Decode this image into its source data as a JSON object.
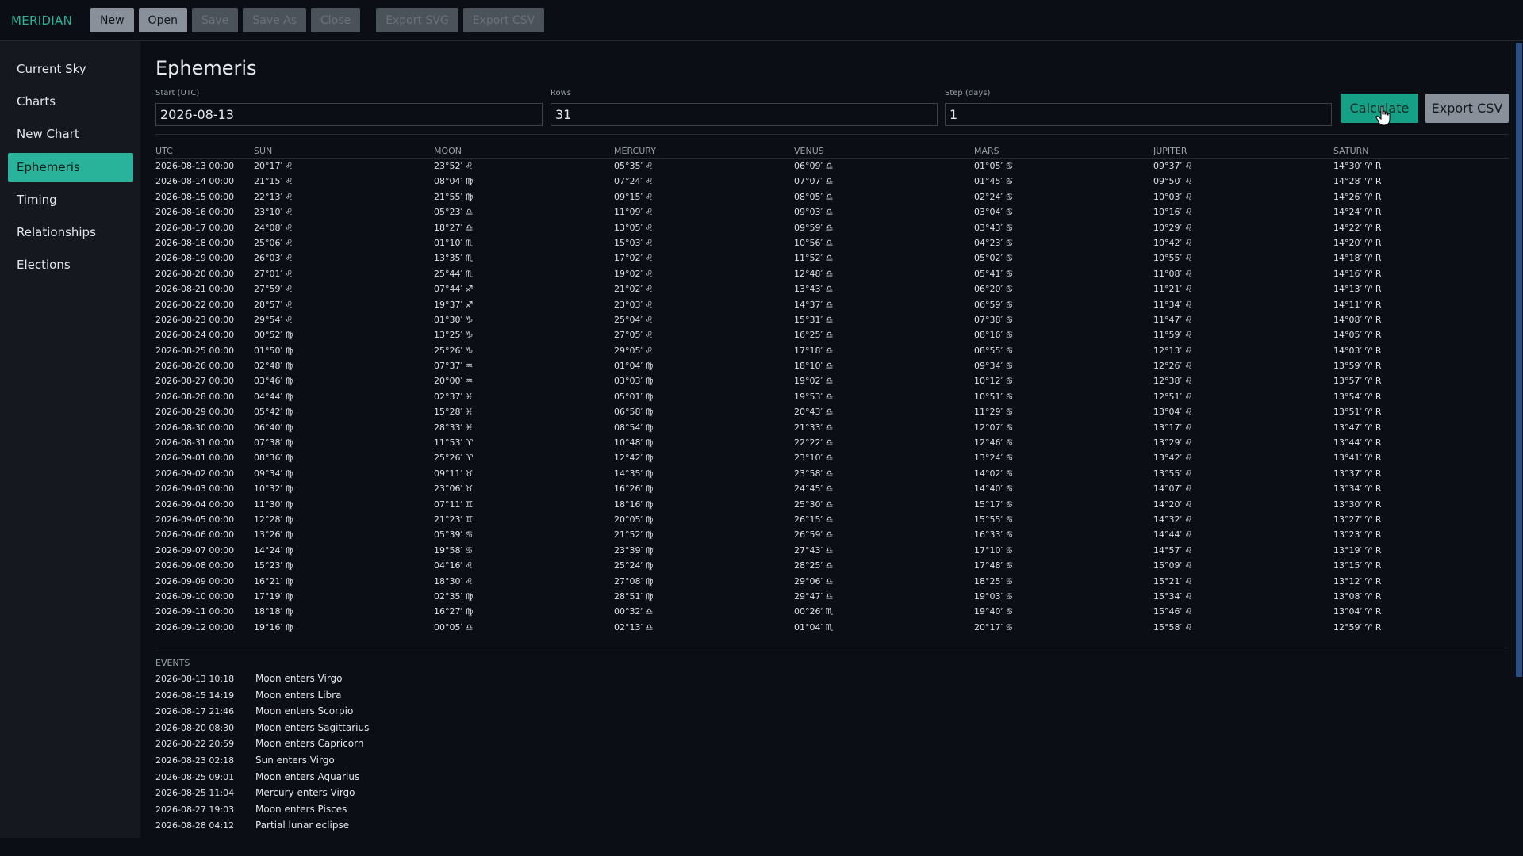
{
  "app": {
    "title": "MERIDIAN"
  },
  "toolbar": {
    "buttons": [
      {
        "label": "New",
        "enabled": true
      },
      {
        "label": "Open",
        "enabled": true
      },
      {
        "label": "Save",
        "enabled": false
      },
      {
        "label": "Save As",
        "enabled": false
      },
      {
        "label": "Close",
        "enabled": false
      },
      {
        "label": "Export SVG",
        "enabled": false
      },
      {
        "label": "Export CSV",
        "enabled": false
      }
    ]
  },
  "sidebar": {
    "items": [
      {
        "label": "Current Sky",
        "active": false
      },
      {
        "label": "Charts",
        "active": false
      },
      {
        "label": "New Chart",
        "active": false
      },
      {
        "label": "Ephemeris",
        "active": true
      },
      {
        "label": "Timing",
        "active": false
      },
      {
        "label": "Relationships",
        "active": false
      },
      {
        "label": "Elections",
        "active": false
      }
    ]
  },
  "page": {
    "title": "Ephemeris",
    "fields": {
      "start": {
        "label": "Start (UTC)",
        "value": "2026-08-13"
      },
      "rows": {
        "label": "Rows",
        "value": "31"
      },
      "step": {
        "label": "Step (days)",
        "value": "1"
      }
    },
    "calculate_label": "Calculate",
    "export_csv_label": "Export CSV"
  },
  "table": {
    "columns": [
      "UTC",
      "SUN",
      "MOON",
      "MERCURY",
      "VENUS",
      "MARS",
      "JUPITER",
      "SATURN"
    ],
    "rows": [
      [
        "2026-08-13 00:00",
        "20°17′ ♌",
        "23°52′ ♌",
        "05°35′ ♌",
        "06°09′ ♎",
        "01°05′ ♋",
        "09°37′ ♌",
        "14°30′ ♈ R"
      ],
      [
        "2026-08-14 00:00",
        "21°15′ ♌",
        "08°04′ ♍",
        "07°24′ ♌",
        "07°07′ ♎",
        "01°45′ ♋",
        "09°50′ ♌",
        "14°28′ ♈ R"
      ],
      [
        "2026-08-15 00:00",
        "22°13′ ♌",
        "21°55′ ♍",
        "09°15′ ♌",
        "08°05′ ♎",
        "02°24′ ♋",
        "10°03′ ♌",
        "14°26′ ♈ R"
      ],
      [
        "2026-08-16 00:00",
        "23°10′ ♌",
        "05°23′ ♎",
        "11°09′ ♌",
        "09°03′ ♎",
        "03°04′ ♋",
        "10°16′ ♌",
        "14°24′ ♈ R"
      ],
      [
        "2026-08-17 00:00",
        "24°08′ ♌",
        "18°27′ ♎",
        "13°05′ ♌",
        "09°59′ ♎",
        "03°43′ ♋",
        "10°29′ ♌",
        "14°22′ ♈ R"
      ],
      [
        "2026-08-18 00:00",
        "25°06′ ♌",
        "01°10′ ♏",
        "15°03′ ♌",
        "10°56′ ♎",
        "04°23′ ♋",
        "10°42′ ♌",
        "14°20′ ♈ R"
      ],
      [
        "2026-08-19 00:00",
        "26°03′ ♌",
        "13°35′ ♏",
        "17°02′ ♌",
        "11°52′ ♎",
        "05°02′ ♋",
        "10°55′ ♌",
        "14°18′ ♈ R"
      ],
      [
        "2026-08-20 00:00",
        "27°01′ ♌",
        "25°44′ ♏",
        "19°02′ ♌",
        "12°48′ ♎",
        "05°41′ ♋",
        "11°08′ ♌",
        "14°16′ ♈ R"
      ],
      [
        "2026-08-21 00:00",
        "27°59′ ♌",
        "07°44′ ♐",
        "21°02′ ♌",
        "13°43′ ♎",
        "06°20′ ♋",
        "11°21′ ♌",
        "14°13′ ♈ R"
      ],
      [
        "2026-08-22 00:00",
        "28°57′ ♌",
        "19°37′ ♐",
        "23°03′ ♌",
        "14°37′ ♎",
        "06°59′ ♋",
        "11°34′ ♌",
        "14°11′ ♈ R"
      ],
      [
        "2026-08-23 00:00",
        "29°54′ ♌",
        "01°30′ ♑",
        "25°04′ ♌",
        "15°31′ ♎",
        "07°38′ ♋",
        "11°47′ ♌",
        "14°08′ ♈ R"
      ],
      [
        "2026-08-24 00:00",
        "00°52′ ♍",
        "13°25′ ♑",
        "27°05′ ♌",
        "16°25′ ♎",
        "08°16′ ♋",
        "11°59′ ♌",
        "14°05′ ♈ R"
      ],
      [
        "2026-08-25 00:00",
        "01°50′ ♍",
        "25°26′ ♑",
        "29°05′ ♌",
        "17°18′ ♎",
        "08°55′ ♋",
        "12°13′ ♌",
        "14°03′ ♈ R"
      ],
      [
        "2026-08-26 00:00",
        "02°48′ ♍",
        "07°37′ ♒",
        "01°04′ ♍",
        "18°10′ ♎",
        "09°34′ ♋",
        "12°26′ ♌",
        "13°59′ ♈ R"
      ],
      [
        "2026-08-27 00:00",
        "03°46′ ♍",
        "20°00′ ♒",
        "03°03′ ♍",
        "19°02′ ♎",
        "10°12′ ♋",
        "12°38′ ♌",
        "13°57′ ♈ R"
      ],
      [
        "2026-08-28 00:00",
        "04°44′ ♍",
        "02°37′ ♓",
        "05°01′ ♍",
        "19°53′ ♎",
        "10°51′ ♋",
        "12°51′ ♌",
        "13°54′ ♈ R"
      ],
      [
        "2026-08-29 00:00",
        "05°42′ ♍",
        "15°28′ ♓",
        "06°58′ ♍",
        "20°43′ ♎",
        "11°29′ ♋",
        "13°04′ ♌",
        "13°51′ ♈ R"
      ],
      [
        "2026-08-30 00:00",
        "06°40′ ♍",
        "28°33′ ♓",
        "08°54′ ♍",
        "21°33′ ♎",
        "12°07′ ♋",
        "13°17′ ♌",
        "13°47′ ♈ R"
      ],
      [
        "2026-08-31 00:00",
        "07°38′ ♍",
        "11°53′ ♈",
        "10°48′ ♍",
        "22°22′ ♎",
        "12°46′ ♋",
        "13°29′ ♌",
        "13°44′ ♈ R"
      ],
      [
        "2026-09-01 00:00",
        "08°36′ ♍",
        "25°26′ ♈",
        "12°42′ ♍",
        "23°10′ ♎",
        "13°24′ ♋",
        "13°42′ ♌",
        "13°41′ ♈ R"
      ],
      [
        "2026-09-02 00:00",
        "09°34′ ♍",
        "09°11′ ♉",
        "14°35′ ♍",
        "23°58′ ♎",
        "14°02′ ♋",
        "13°55′ ♌",
        "13°37′ ♈ R"
      ],
      [
        "2026-09-03 00:00",
        "10°32′ ♍",
        "23°06′ ♉",
        "16°26′ ♍",
        "24°45′ ♎",
        "14°40′ ♋",
        "14°07′ ♌",
        "13°34′ ♈ R"
      ],
      [
        "2026-09-04 00:00",
        "11°30′ ♍",
        "07°11′ ♊",
        "18°16′ ♍",
        "25°30′ ♎",
        "15°17′ ♋",
        "14°20′ ♌",
        "13°30′ ♈ R"
      ],
      [
        "2026-09-05 00:00",
        "12°28′ ♍",
        "21°23′ ♊",
        "20°05′ ♍",
        "26°15′ ♎",
        "15°55′ ♋",
        "14°32′ ♌",
        "13°27′ ♈ R"
      ],
      [
        "2026-09-06 00:00",
        "13°26′ ♍",
        "05°39′ ♋",
        "21°52′ ♍",
        "26°59′ ♎",
        "16°33′ ♋",
        "14°44′ ♌",
        "13°23′ ♈ R"
      ],
      [
        "2026-09-07 00:00",
        "14°24′ ♍",
        "19°58′ ♋",
        "23°39′ ♍",
        "27°43′ ♎",
        "17°10′ ♋",
        "14°57′ ♌",
        "13°19′ ♈ R"
      ],
      [
        "2026-09-08 00:00",
        "15°23′ ♍",
        "04°16′ ♌",
        "25°24′ ♍",
        "28°25′ ♎",
        "17°48′ ♋",
        "15°09′ ♌",
        "13°15′ ♈ R"
      ],
      [
        "2026-09-09 00:00",
        "16°21′ ♍",
        "18°30′ ♌",
        "27°08′ ♍",
        "29°06′ ♎",
        "18°25′ ♋",
        "15°21′ ♌",
        "13°12′ ♈ R"
      ],
      [
        "2026-09-10 00:00",
        "17°19′ ♍",
        "02°35′ ♍",
        "28°51′ ♍",
        "29°47′ ♎",
        "19°03′ ♋",
        "15°34′ ♌",
        "13°08′ ♈ R"
      ],
      [
        "2026-09-11 00:00",
        "18°18′ ♍",
        "16°27′ ♍",
        "00°32′ ♎",
        "00°26′ ♏",
        "19°40′ ♋",
        "15°46′ ♌",
        "13°04′ ♈ R"
      ],
      [
        "2026-09-12 00:00",
        "19°16′ ♍",
        "00°05′ ♎",
        "02°13′ ♎",
        "01°04′ ♏",
        "20°17′ ♋",
        "15°58′ ♌",
        "12°59′ ♈ R"
      ]
    ]
  },
  "events": {
    "label": "EVENTS",
    "items": [
      {
        "time": "2026-08-13 10:18",
        "text": "Moon enters Virgo"
      },
      {
        "time": "2026-08-15 14:19",
        "text": "Moon enters Libra"
      },
      {
        "time": "2026-08-17 21:46",
        "text": "Moon enters Scorpio"
      },
      {
        "time": "2026-08-20 08:30",
        "text": "Moon enters Sagittarius"
      },
      {
        "time": "2026-08-22 20:59",
        "text": "Moon enters Capricorn"
      },
      {
        "time": "2026-08-23 02:18",
        "text": "Sun enters Virgo"
      },
      {
        "time": "2026-08-25 09:01",
        "text": "Moon enters Aquarius"
      },
      {
        "time": "2026-08-25 11:04",
        "text": "Mercury enters Virgo"
      },
      {
        "time": "2026-08-27 19:03",
        "text": "Moon enters Pisces"
      },
      {
        "time": "2026-08-28 04:12",
        "text": "Partial lunar eclipse"
      }
    ]
  },
  "colors": {
    "accent": "#2ab39b",
    "calculate_bg": "#16a085",
    "background": "#0b0e14",
    "sidebar_bg": "#15181f",
    "scroll_thumb": "#2c4f84"
  }
}
